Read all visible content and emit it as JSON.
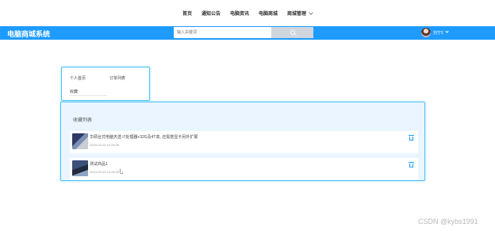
{
  "topnav": {
    "items": [
      "首页",
      "通知公告",
      "电脑资讯",
      "电脑商城",
      "商城管理"
    ]
  },
  "header": {
    "brand": "电脑商城系统",
    "search_placeholder": "输入关键词",
    "username": "刘宁2"
  },
  "menu": {
    "items": [
      "个人首页",
      "订单列表",
      "收藏"
    ]
  },
  "favorites": {
    "title": "收藏列表",
    "items": [
      {
        "name": "华硕台式电脑天选 i7处理器+32G及4T高, 还需搭显卡另外扩展",
        "time": "2024-03-10 14:28:26"
      },
      {
        "name": "测试商品1",
        "time": "2024-03-10 14:28:33"
      }
    ]
  },
  "watermark": "CSDN @kybs1991",
  "colors": {
    "header_bg": "#1e9bff",
    "panel_border": "#4cc3f5",
    "panel_bg": "#eaf5ff",
    "accent": "#1e9bff"
  }
}
